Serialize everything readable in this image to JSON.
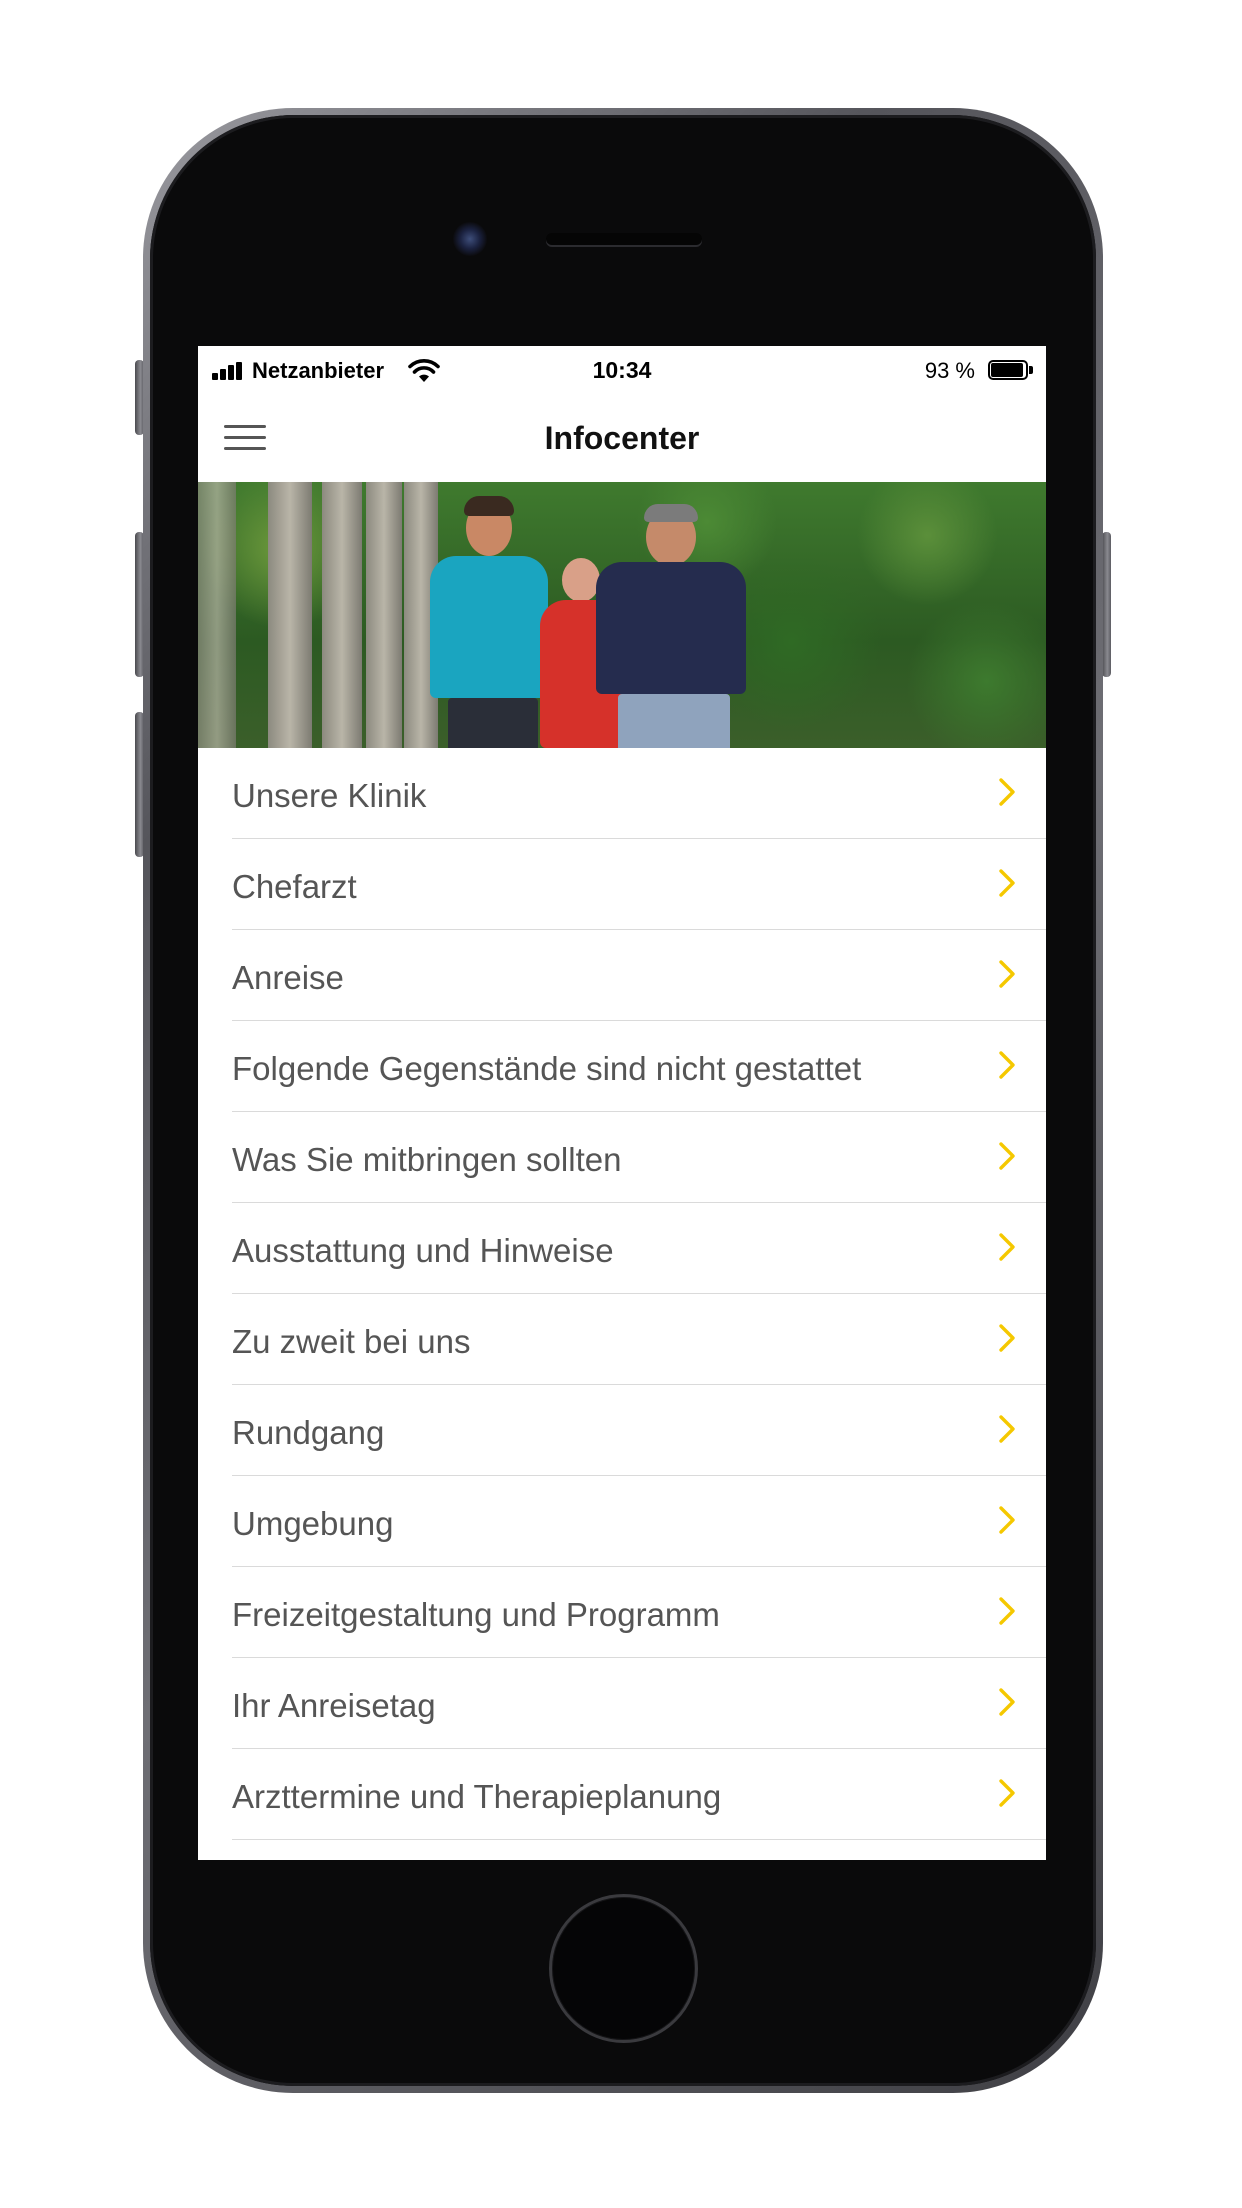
{
  "status_bar": {
    "carrier": "Netzanbieter",
    "time": "10:34",
    "battery_percent": "93 %",
    "battery_level": 0.93
  },
  "nav": {
    "title": "Infocenter",
    "menu_icon": "hamburger-menu-icon"
  },
  "hero": {
    "image_alt": "three-men-nordic-walking-photo"
  },
  "accent_color": "#f5c800",
  "list": {
    "chevron_icon": "chevron-right-icon",
    "items": [
      {
        "label": "Unsere Klinik"
      },
      {
        "label": "Chefarzt"
      },
      {
        "label": "Anreise"
      },
      {
        "label": "Folgende Gegenstände sind nicht gestattet"
      },
      {
        "label": "Was Sie mitbringen sollten"
      },
      {
        "label": "Ausstattung und Hinweise"
      },
      {
        "label": "Zu zweit bei uns"
      },
      {
        "label": "Rundgang"
      },
      {
        "label": "Umgebung"
      },
      {
        "label": "Freizeitgestaltung und Programm"
      },
      {
        "label": "Ihr Anreisetag"
      },
      {
        "label": "Arzttermine und Therapieplanung"
      }
    ]
  }
}
